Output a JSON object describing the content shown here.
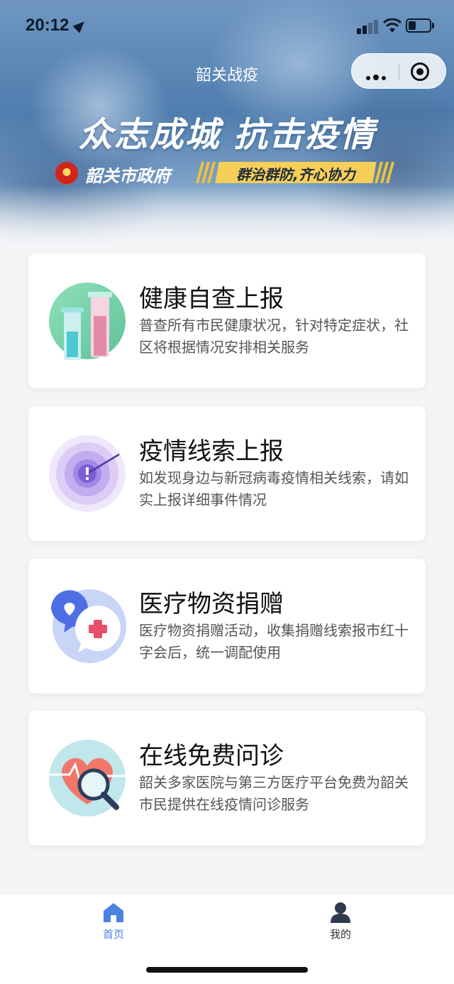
{
  "status_bar": {
    "time": "20:12"
  },
  "nav": {
    "title": "韶关战疫"
  },
  "banner": {
    "headline": "众志成城  抗击疫情",
    "gov_name": "韶关市政府",
    "slogan": "群治群防,齐心协力"
  },
  "cards": [
    {
      "title": "健康自查上报",
      "desc": "普查所有市民健康状况，针对特定症状，社区将根据情况安排相关服务",
      "icon": "test-tubes-icon"
    },
    {
      "title": "疫情线索上报",
      "desc": "如发现身边与新冠病毒疫情相关线索，请如实上报详细事件情况",
      "icon": "alert-radar-icon"
    },
    {
      "title": "医疗物资捐赠",
      "desc": "医疗物资捐赠活动，收集捐赠线索报市红十字会后，统一调配使用",
      "icon": "donation-chat-icon"
    },
    {
      "title": "在线免费问诊",
      "desc": "韶关多家医院与第三方医疗平台免费为韶关市民提供在线疫情问诊服务",
      "icon": "heart-magnifier-icon"
    }
  ],
  "tabbar": {
    "items": [
      {
        "label": "首页",
        "icon": "home-icon",
        "active": true
      },
      {
        "label": "我的",
        "icon": "user-icon",
        "active": false
      }
    ]
  },
  "colors": {
    "accent": "#4a82e0",
    "slogan_bg": "#f6cf58",
    "tab_inactive": "#333333"
  }
}
